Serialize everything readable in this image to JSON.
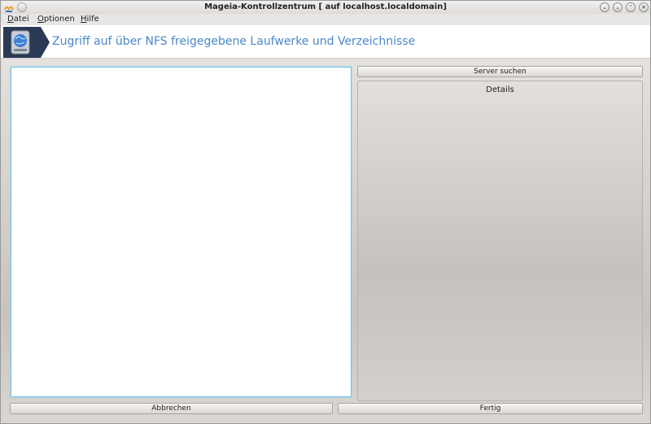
{
  "window": {
    "title": "Mageia-Kontrollzentrum  [ auf localhost.localdomain]",
    "controls": {
      "shade": "⌄",
      "minimize": "⌄",
      "maximize": "⌃",
      "close": "✕"
    }
  },
  "menubar": {
    "items": [
      {
        "first": "D",
        "rest": "atei"
      },
      {
        "first": "O",
        "rest": "ptionen"
      },
      {
        "first": "H",
        "rest": "ilfe"
      }
    ]
  },
  "banner": {
    "title": "Zugriff auf über NFS freigegebene Laufwerke und Verzeichnisse",
    "icon": "nfs-network-drive-icon"
  },
  "main": {
    "server_list": [],
    "search_button": "Server suchen",
    "details_title": "Details"
  },
  "footer": {
    "cancel_label": "Abbrechen",
    "done_label": "Fertig"
  },
  "colors": {
    "accent": "#4a87c9",
    "focus_border": "#6fc3e6",
    "banner_icon_bg": "#2a3a55"
  }
}
